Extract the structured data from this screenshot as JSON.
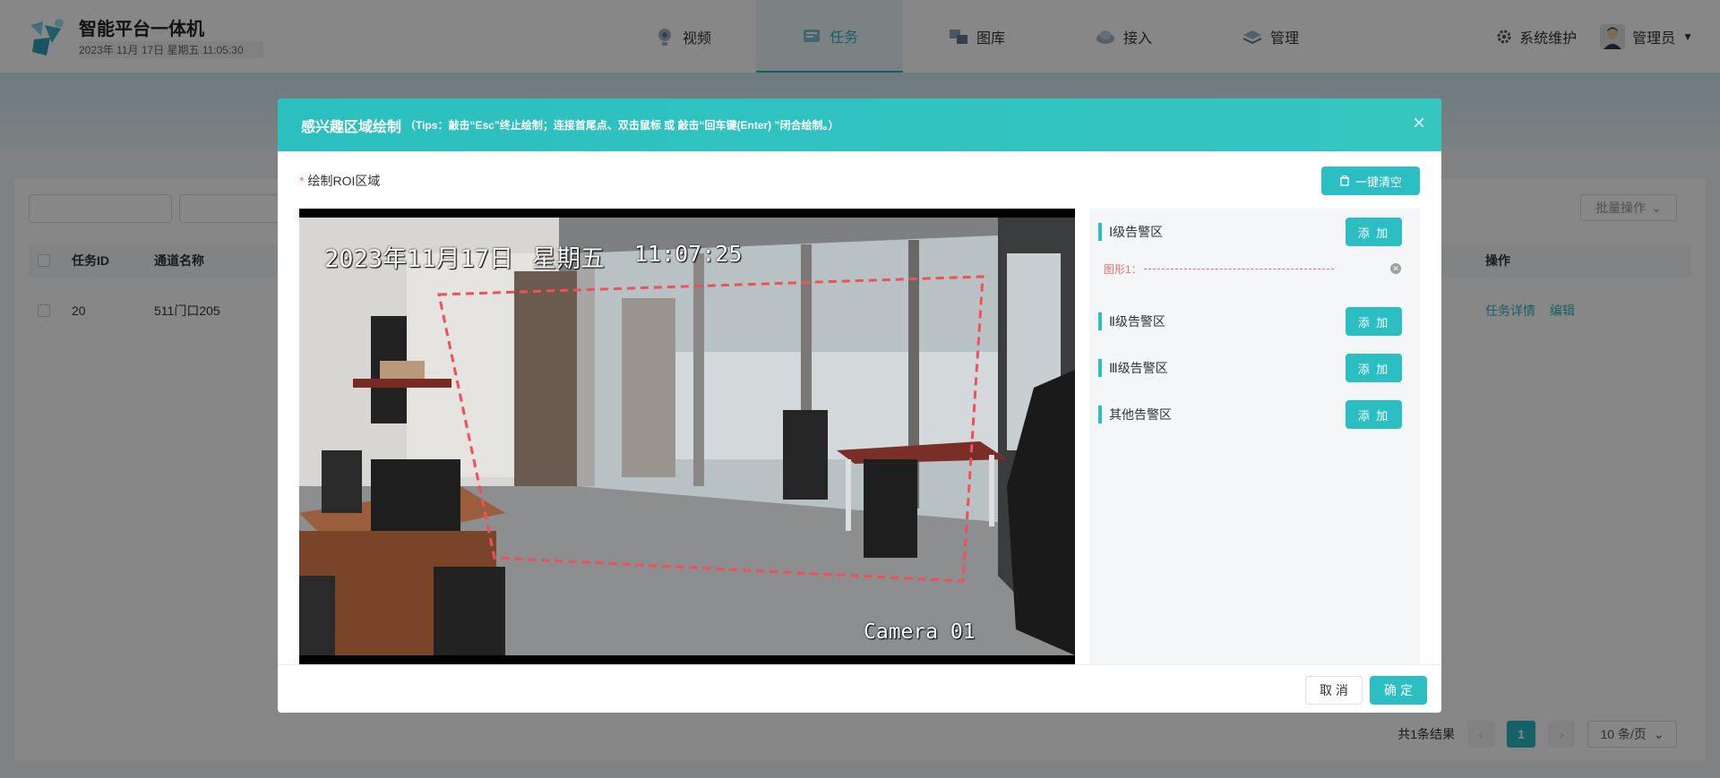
{
  "header": {
    "app_title": "智能平台一体机",
    "datetime": "2023年 11月 17日 星期五 11:05:30",
    "nav": [
      {
        "label": "视频",
        "icon": "video-icon",
        "active": false
      },
      {
        "label": "任务",
        "icon": "task-icon",
        "active": true
      },
      {
        "label": "图库",
        "icon": "gallery-icon",
        "active": false
      },
      {
        "label": "接入",
        "icon": "access-icon",
        "active": false
      },
      {
        "label": "管理",
        "icon": "manage-icon",
        "active": false
      }
    ],
    "maintenance_label": "系统维护",
    "user_label": "管理员"
  },
  "toolbar": {
    "batch_label": "批量操作"
  },
  "table": {
    "headers": {
      "id": "任务ID",
      "channel": "通道名称",
      "actions": "操作"
    },
    "rows": [
      {
        "id": "20",
        "channel": "511门口205",
        "detail": "任务详情",
        "edit": "编辑"
      }
    ]
  },
  "pagination": {
    "total": "共1条结果",
    "page": "1",
    "page_size": "10 条/页"
  },
  "modal": {
    "title": "感兴趣区域绘制",
    "tips": "（Tips：敲击“Esc”终止绘制；连接首尾点、双击鼠标 或 敲击“回车键(Enter) ”闭合绘制。）",
    "roi_label": "绘制ROI区域",
    "clear_label": "一键清空",
    "video": {
      "osd_date": "2023年11月17日",
      "osd_week": "星期五",
      "osd_time": "11:07:25",
      "osd_camera": "Camera 01"
    },
    "zones": [
      {
        "label": "Ⅰ级告警区",
        "add": "添 加"
      },
      {
        "label": "Ⅱ级告警区",
        "add": "添 加"
      },
      {
        "label": "Ⅲ级告警区",
        "add": "添 加"
      },
      {
        "label": "其他告警区",
        "add": "添 加"
      }
    ],
    "shape_label": "图形1：",
    "cancel_label": "取 消",
    "ok_label": "确 定"
  },
  "colors": {
    "accent": "#2bbfc4",
    "danger": "#f56c6c"
  }
}
